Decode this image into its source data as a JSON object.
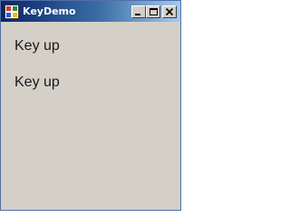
{
  "window": {
    "title": "KeyDemo",
    "buttons": {
      "minimize_icon": "minimize-icon",
      "maximize_icon": "maximize-icon",
      "close_icon": "close-icon"
    }
  },
  "labels": [
    {
      "text": "Key up"
    },
    {
      "text": "Key up"
    }
  ],
  "colors": {
    "titlebar_start": "#0a246a",
    "titlebar_end": "#a6caf0",
    "client_background": "#d4d0c8",
    "label_text": "#1a1a1a"
  }
}
